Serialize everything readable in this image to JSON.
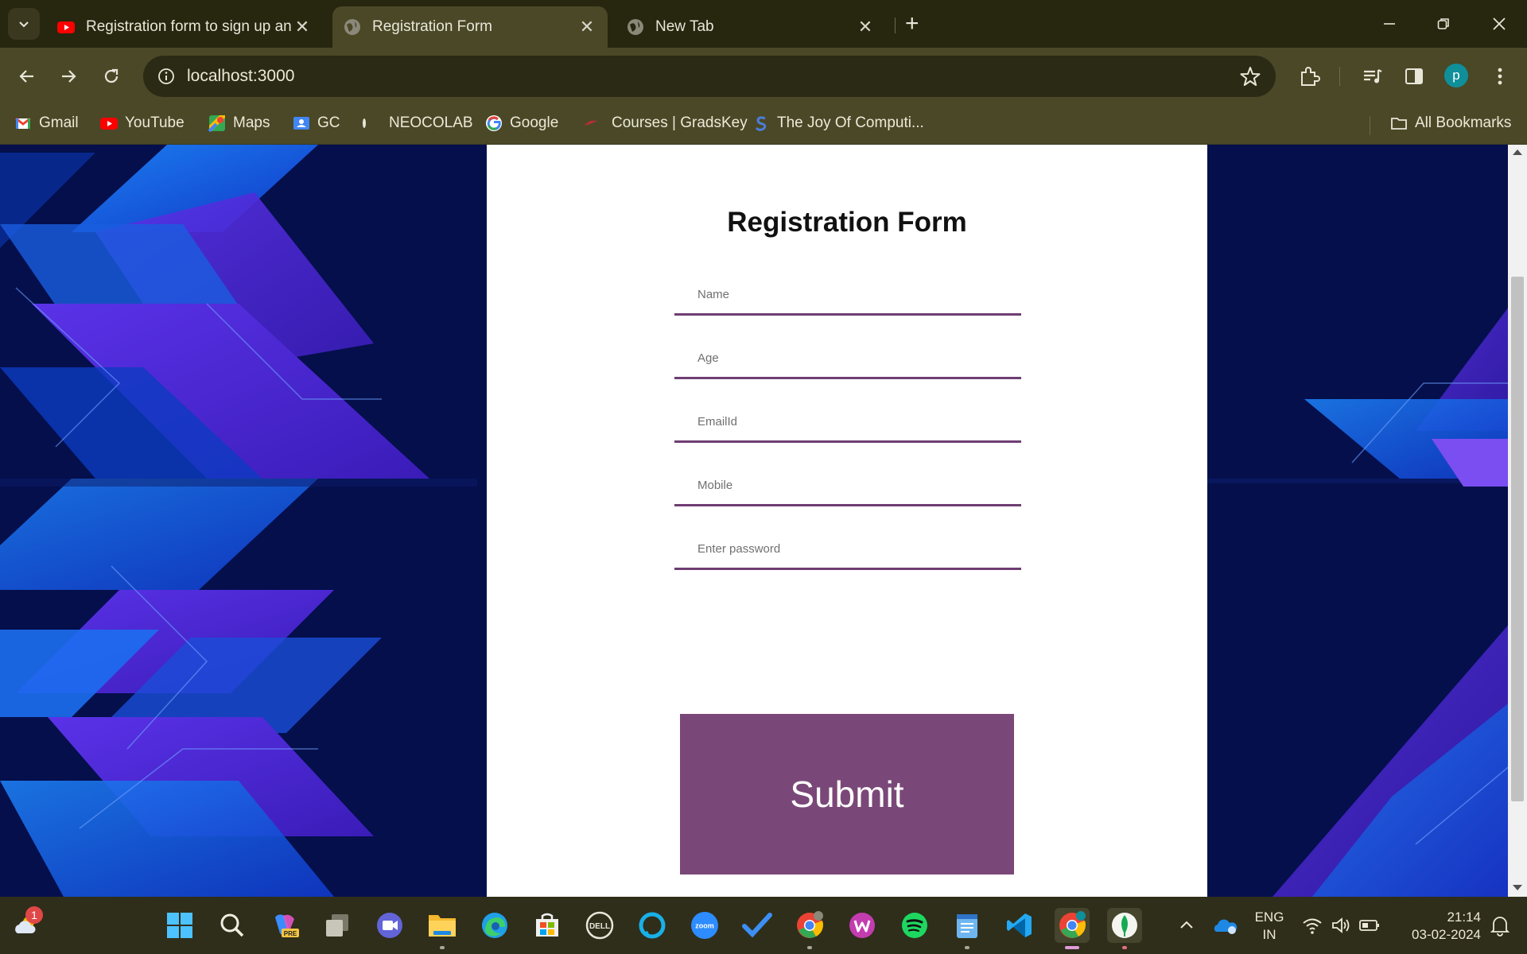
{
  "browser": {
    "tabs": [
      {
        "title": "Registration form to sign up an",
        "favicon": "youtube-icon",
        "active": false
      },
      {
        "title": "Registration Form",
        "favicon": "globe-icon",
        "active": true
      },
      {
        "title": "New Tab",
        "favicon": "globe-icon",
        "active": false
      }
    ],
    "address": "localhost:3000",
    "bookmarks": [
      {
        "label": "Gmail",
        "icon": "gmail-icon"
      },
      {
        "label": "YouTube",
        "icon": "youtube-icon"
      },
      {
        "label": "Maps",
        "icon": "maps-icon"
      },
      {
        "label": "GC",
        "icon": "classroom-icon"
      },
      {
        "label": "NEOCOLAB",
        "icon": "neocolab-icon"
      },
      {
        "label": "Google",
        "icon": "google-icon"
      },
      {
        "label": "Courses | GradsKey",
        "icon": "gradskey-icon"
      },
      {
        "label": "The Joy Of Computi...",
        "icon": "swayam-icon"
      }
    ],
    "all_bookmarks_label": "All Bookmarks",
    "profile_initial": "p"
  },
  "form": {
    "title": "Registration Form",
    "fields": {
      "name": "Name",
      "age": "Age",
      "email": "EmailId",
      "mobile": "Mobile",
      "password": "Enter password"
    },
    "submit_label": "Submit",
    "accent_color": "#7a4878"
  },
  "taskbar": {
    "weather_badge": "1",
    "copilot_tag": "PRE",
    "dell_label": "DELL",
    "zoom_label": "zoom",
    "language_line1": "ENG",
    "language_line2": "IN",
    "time": "21:14",
    "date": "03-02-2024"
  }
}
